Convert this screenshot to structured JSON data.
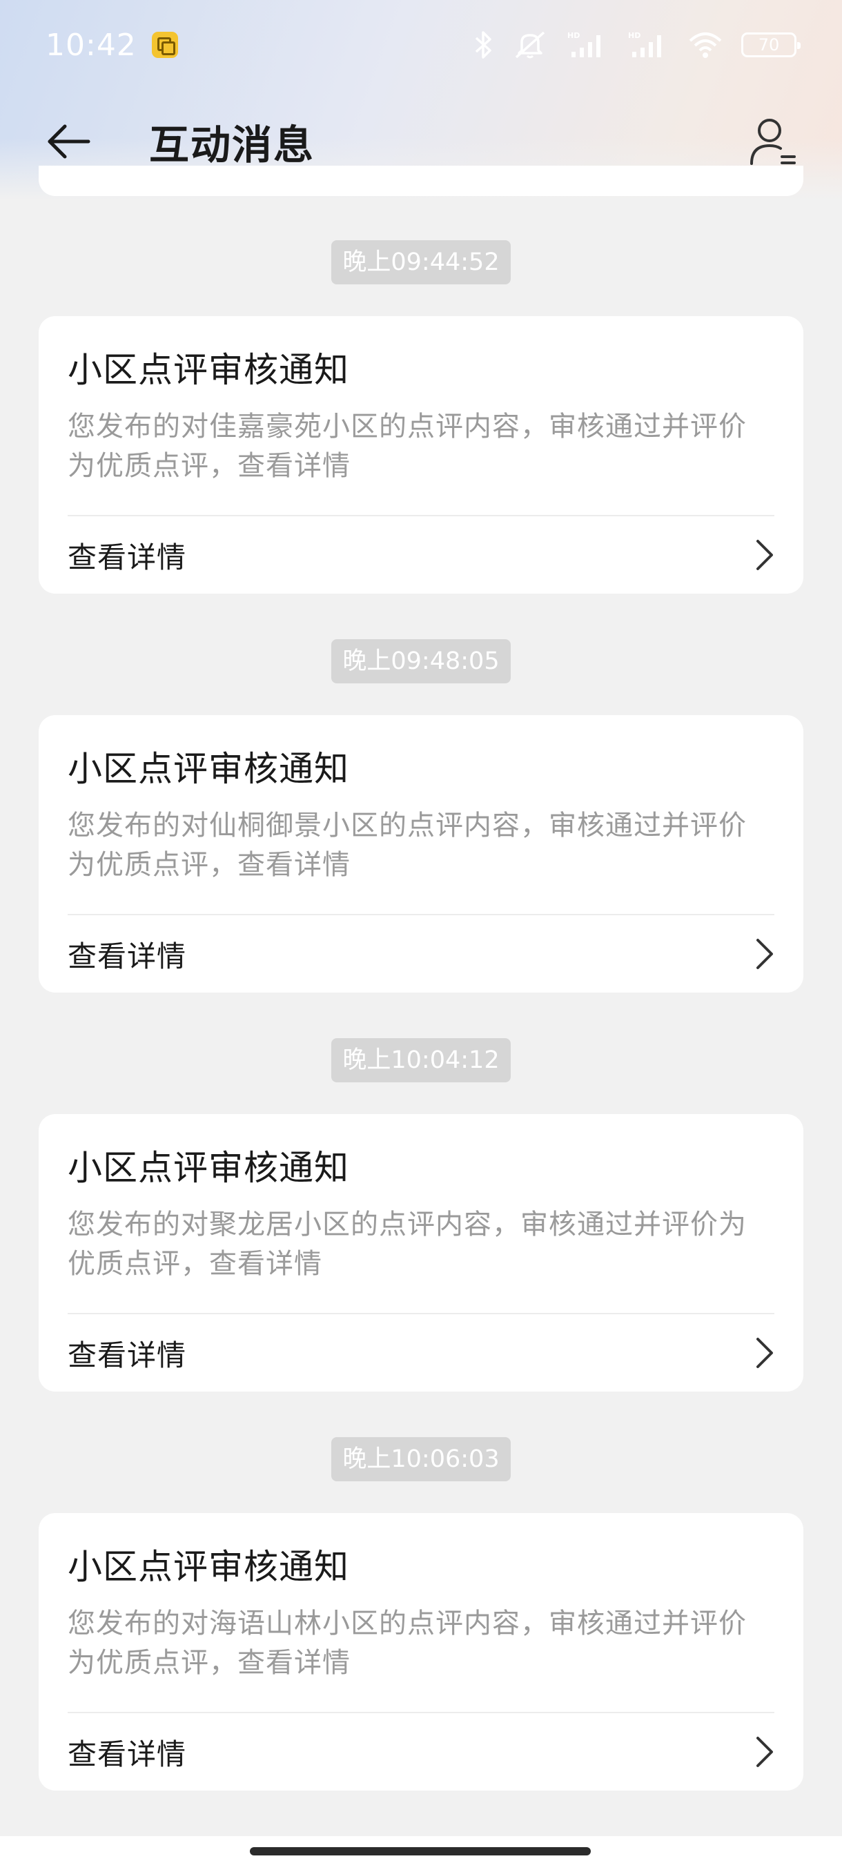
{
  "status_bar": {
    "time": "10:42",
    "battery": "70",
    "icons": [
      "notification-badge-icon",
      "bluetooth-icon",
      "mute-icon",
      "hd-signal-icon",
      "hd-signal-icon",
      "wifi-icon",
      "battery-icon"
    ],
    "hd_label": "HD"
  },
  "nav": {
    "title": "互动消息",
    "back_icon": "back-arrow-icon",
    "profile_icon": "user-settings-icon"
  },
  "messages": [
    {
      "time": "晚上09:44:52",
      "title": "小区点评审核通知",
      "body": "您发布的对佳嘉豪苑小区的点评内容，审核通过并评价为优质点评，查看详情",
      "link": "查看详情"
    },
    {
      "time": "晚上09:48:05",
      "title": "小区点评审核通知",
      "body": "您发布的对仙桐御景小区的点评内容，审核通过并评价为优质点评，查看详情",
      "link": "查看详情"
    },
    {
      "time": "晚上10:04:12",
      "title": "小区点评审核通知",
      "body": "您发布的对聚龙居小区的点评内容，审核通过并评价为优质点评，查看详情",
      "link": "查看详情"
    },
    {
      "time": "晚上10:06:03",
      "title": "小区点评审核通知",
      "body": "您发布的对海语山林小区的点评内容，审核通过并评价为优质点评，查看详情",
      "link": "查看详情"
    }
  ],
  "colors": {
    "background": "#f1f1f1",
    "card": "#ffffff",
    "title_text": "#1a1a1a",
    "body_text": "#9a9a9a",
    "time_pill": "#d6d6d6"
  }
}
